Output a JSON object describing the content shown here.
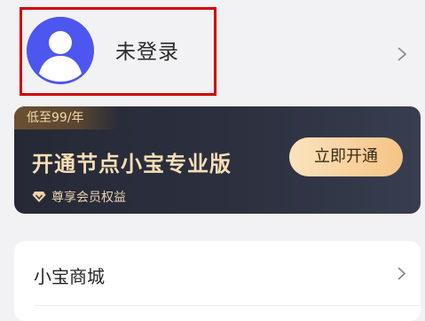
{
  "profile": {
    "login_status": "未登录",
    "avatar_icon": "user-avatar-icon",
    "chevron_icon": "chevron-right-icon"
  },
  "vip_card": {
    "price_tag": "低至99/年",
    "title": "开通节点小宝专业版",
    "benefit_icon": "diamond-icon",
    "benefit_label": "尊享会员权益",
    "button_label": "立即开通"
  },
  "menu": {
    "items": [
      {
        "label": "小宝商城",
        "icon": "chevron-right-icon"
      }
    ]
  },
  "colors": {
    "avatar": "#4d57ef",
    "highlight_border": "#d40000",
    "card_dark": "#2a2d3a",
    "gold_text": "#f8dfb6",
    "button_gold": "#f5c486"
  }
}
